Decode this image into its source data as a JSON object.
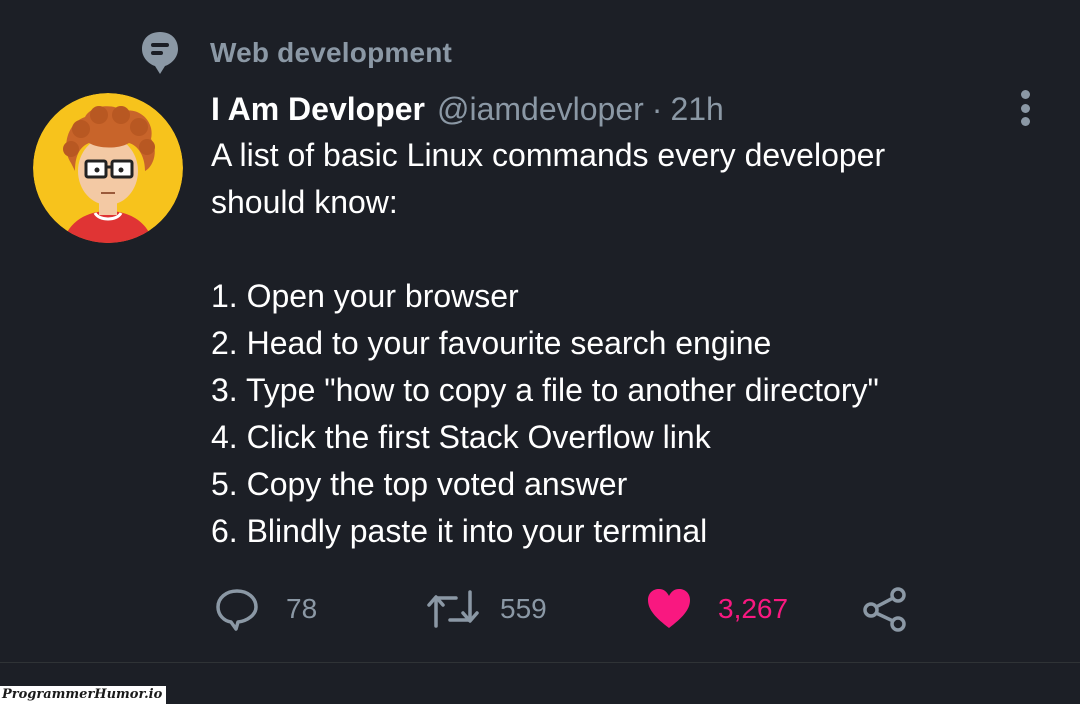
{
  "topic": {
    "icon": "topic-bubble-icon",
    "label": "Web development"
  },
  "author": {
    "name": "I Am Devloper",
    "handle": "@iamdevloper",
    "separator": "·",
    "time": "21h",
    "avatar": "cartoon-developer-avatar"
  },
  "tweet": {
    "intro_lines": [
      "A list of basic Linux commands every developer",
      "should know:"
    ],
    "steps": [
      "1. Open your browser",
      "2. Head to your favourite search engine",
      "3. Type \"how to copy a file to another directory\"",
      "4. Click the first Stack Overflow link",
      "5. Copy the top voted answer",
      "6. Blindly paste it into your terminal"
    ]
  },
  "actions": {
    "reply": {
      "icon": "reply-icon",
      "count": "78"
    },
    "retweet": {
      "icon": "retweet-icon",
      "count": "559"
    },
    "like": {
      "icon": "heart-icon",
      "count": "3,267",
      "liked": true
    },
    "share": {
      "icon": "share-icon"
    }
  },
  "menu": {
    "icon": "more-vertical-icon"
  },
  "watermark": "ProgrammerHumor.io",
  "colors": {
    "background": "#1c1f26",
    "text_primary": "#ffffff",
    "text_secondary": "#8b98a5",
    "like_accent": "#f91880",
    "avatar_bg": "#f7c31c"
  }
}
